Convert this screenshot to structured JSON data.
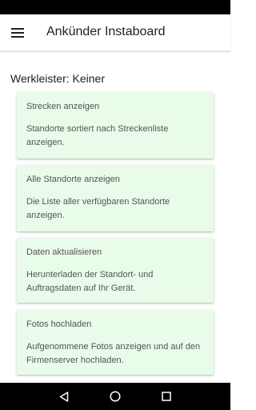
{
  "app_bar": {
    "title": "Ankünder Instaboard",
    "menu_icon": "hamburger-menu-icon"
  },
  "section": {
    "title": "Werkleister: Keiner"
  },
  "cards": [
    {
      "title": "Strecken anzeigen",
      "description": "Standorte sortiert nach Streckenliste anzeigen."
    },
    {
      "title": "Alle Standorte anzeigen",
      "description": "Die Liste aller verfügbaren Standorte anzeigen."
    },
    {
      "title": "Daten aktualisieren",
      "description": "Herunterladen der Standort- und Auftragsdaten auf Ihr Gerät."
    },
    {
      "title": "Fotos hochladen",
      "description": "Aufgenommene Fotos anzeigen und auf den Firmenserver hochladen."
    }
  ],
  "nav_bar": {
    "icons": [
      "back-icon",
      "home-icon",
      "recents-icon"
    ]
  },
  "colors": {
    "card_background": "#e9fbe9",
    "status_bar": "#000000",
    "nav_bar": "#000000"
  }
}
